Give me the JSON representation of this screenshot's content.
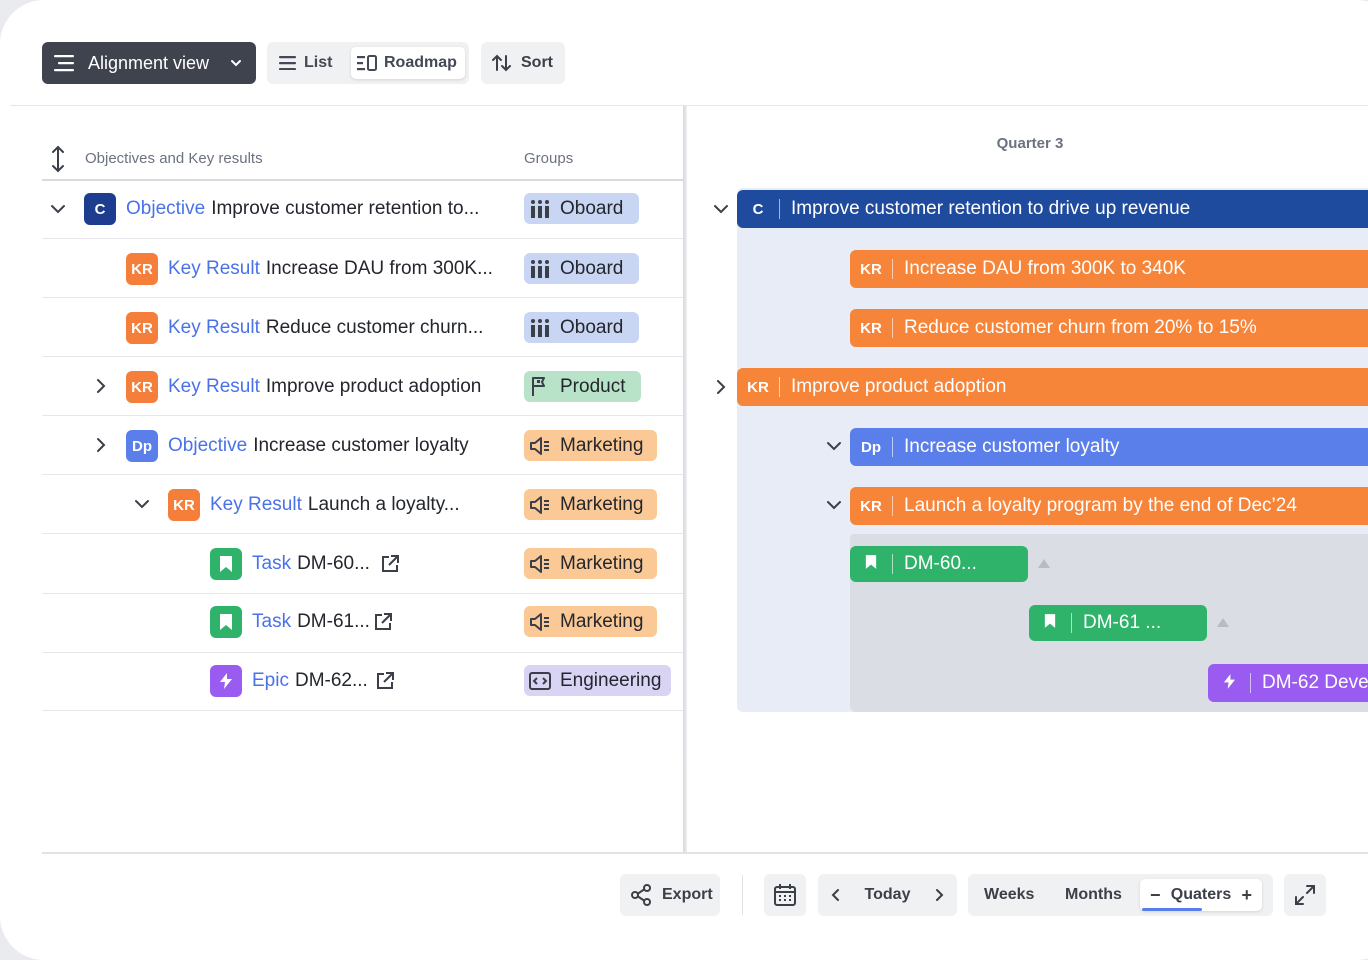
{
  "toolbar": {
    "alignment_label": "Alignment view",
    "list_label": "List",
    "roadmap_label": "Roadmap",
    "sort_label": "Sort"
  },
  "table": {
    "col_okr": "Objectives and Key results",
    "col_groups": "Groups",
    "rows": [
      {
        "badge": "C",
        "type": "Objective",
        "text": "Improve customer retention to...",
        "group": "Oboard"
      },
      {
        "badge": "KR",
        "type": "Key Result",
        "text": "Increase DAU from 300K...",
        "group": "Oboard"
      },
      {
        "badge": "KR",
        "type": "Key Result",
        "text": "Reduce customer churn...",
        "group": "Oboard"
      },
      {
        "badge": "KR",
        "type": "Key Result",
        "text": "Improve product adoption",
        "group": "Product"
      },
      {
        "badge": "Dp",
        "type": "Objective",
        "text": "Increase customer loyalty",
        "group": "Marketing"
      },
      {
        "badge": "KR",
        "type": "Key Result",
        "text": "Launch a loyalty...",
        "group": "Marketing"
      },
      {
        "badge": "",
        "type": "Task",
        "text": "DM-60...",
        "group": "Marketing"
      },
      {
        "badge": "",
        "type": "Task",
        "text": "DM-61...",
        "group": "Marketing"
      },
      {
        "badge": "",
        "type": "Epic",
        "text": "DM-62...",
        "group": "Engineering"
      }
    ]
  },
  "roadmap": {
    "period": "Quarter 3",
    "bars": [
      {
        "badge": "C",
        "text": "Improve customer retention to drive up revenue"
      },
      {
        "badge": "KR",
        "text": "Increase DAU from 300K to 340K"
      },
      {
        "badge": "KR",
        "text": "Reduce customer churn from 20% to 15%"
      },
      {
        "badge": "KR",
        "text": "Improve product adoption"
      },
      {
        "badge": "Dp",
        "text": "Increase customer loyalty"
      },
      {
        "badge": "KR",
        "text": "Launch a loyalty program by the end of Dec’24"
      },
      {
        "badge": "",
        "text": "DM-60..."
      },
      {
        "badge": "",
        "text": "DM-61 ..."
      },
      {
        "badge": "",
        "text": "DM-62 Deve"
      }
    ]
  },
  "footer": {
    "export_label": "Export",
    "today_label": "Today",
    "weeks_label": "Weeks",
    "months_label": "Months",
    "quarters_label": "Quaters"
  },
  "colors": {
    "objective_company": "#1e4b9e",
    "key_result": "#f68439",
    "objective_dept": "#5b7fea",
    "task": "#2fb36b",
    "epic": "#9a5cf0",
    "link_blue": "#4a72e8"
  }
}
